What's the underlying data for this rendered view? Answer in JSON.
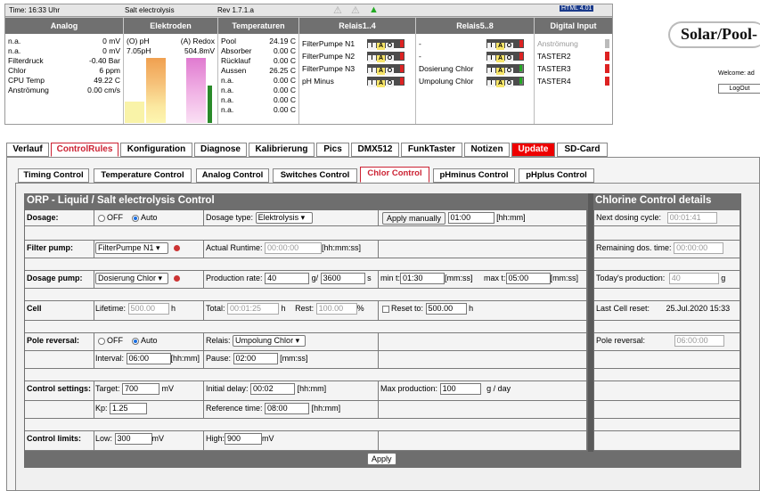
{
  "topbar": {
    "time": "Time: 16:33 Uhr",
    "system": "Salt electrolysis",
    "rev": "Rev 1.7.1.a",
    "html_badge": "HTML 4.01"
  },
  "headers": {
    "analog": "Analog",
    "elektroden": "Elektroden",
    "temps": "Temperaturen",
    "relais14": "Relais1..4",
    "relais58": "Relais5..8",
    "digital": "Digital Input"
  },
  "analog": [
    {
      "name": "n.a.",
      "value": "0 mV"
    },
    {
      "name": "n.a.",
      "value": "0 mV"
    },
    {
      "name": "Filterdruck",
      "value": "-0.40 Bar"
    },
    {
      "name": "Chlor",
      "value": "6 ppm"
    },
    {
      "name": "CPU Temp",
      "value": "49.22 C"
    },
    {
      "name": "Anströmung",
      "value": "0.00 cm/s"
    }
  ],
  "electrodes": {
    "ph_label": "(O) pH",
    "ph_value": "7.05pH",
    "redox_label": "(A) Redox",
    "redox_value": "504.8mV"
  },
  "temps": [
    {
      "name": "Pool",
      "value": "24.19 C"
    },
    {
      "name": "Absorber",
      "value": "0.00 C"
    },
    {
      "name": "Rücklauf",
      "value": "0.00 C"
    },
    {
      "name": "Aussen",
      "value": "26.25 C"
    },
    {
      "name": "n.a.",
      "value": "0.00 C"
    },
    {
      "name": "n.a.",
      "value": "0.00 C"
    },
    {
      "name": "n.a.",
      "value": "0.00 C"
    },
    {
      "name": "n.a.",
      "value": "0.00 C"
    }
  ],
  "relais14": [
    "FilterPumpe N1",
    "FilterPumpe N2",
    "FilterPumpe N3",
    "pH Minus"
  ],
  "relais58": [
    "-",
    "-",
    "Dosierung Chlor",
    "Umpolung Chlor"
  ],
  "iao": {
    "i": "I",
    "a": "A",
    "o": "O"
  },
  "digital": [
    "Anströmung",
    "TASTER2",
    "TASTER3",
    "TASTER4"
  ],
  "brand": {
    "logo": "Solar/Pool-",
    "welcome": "Welcome:  ad",
    "logout": "LogOut"
  },
  "tabs": [
    "Verlauf",
    "ControlRules",
    "Konfiguration",
    "Diagnose",
    "Kalibrierung",
    "Pics",
    "DMX512",
    "FunkTaster",
    "Notizen",
    "Update",
    "SD-Card"
  ],
  "subtabs": [
    "Timing Control",
    "Temperature Control",
    "Analog Control",
    "Switches Control",
    "Chlor Control",
    "pHminus Control",
    "pHplus Control"
  ],
  "orp": {
    "title": "ORP - Liquid / Salt electrolysis Control",
    "dosage_label": "Dosage:",
    "off": "OFF",
    "auto": "Auto",
    "dosage_type_label": "Dosage type:",
    "dosage_type": "Elektrolysis",
    "apply_manually": "Apply manually",
    "manual_time": "01:00",
    "hhmm": "[hh:mm]",
    "filter_label": "Filter pump:",
    "filter_sel": "FilterPumpe N1",
    "runtime_label": "Actual Runtime:",
    "runtime": "00:00:00",
    "hhmmss": "[hh:mm:ss]",
    "pump_label": "Dosage pump:",
    "pump_sel": "Dosierung Chlor",
    "prod_label": "Production rate:",
    "prod_g": "40",
    "g_slash": "g/",
    "prod_s": "3600",
    "s": "s",
    "min_label": "min t:",
    "min_t": "01:30",
    "mmss": "[mm:ss]",
    "max_label": "max t:",
    "max_t": "05:00",
    "cell_label": "Cell",
    "lifetime_label": "Lifetime:",
    "lifetime": "500.00",
    "h": "h",
    "total_label": "Total:",
    "total": "00:01:25",
    "rest_label": "Rest:",
    "rest": "100.00",
    "pct": "%",
    "reset_label": "Reset to:",
    "reset_to": "500.00",
    "pole_label": "Pole reversal:",
    "relais_label": "Relais:",
    "relais_sel": "Umpolung Chlor",
    "interval_label": "Interval:",
    "interval": "06:00",
    "pause_label": "Pause:",
    "pause": "02:00",
    "settings_label": "Control settings:",
    "target_label": "Target:",
    "target": "700",
    "mv": "mV",
    "delay_label": "Initial delay:",
    "delay": "00:02",
    "maxprod_label": "Max production:",
    "maxprod": "100",
    "gday": "g / day",
    "kp_label": "Kp:",
    "kp": "1.25",
    "ref_label": "Reference time:",
    "ref": "08:00",
    "limits_label": "Control limits:",
    "low_label": "Low:",
    "low": "300",
    "high_label": "High:",
    "high": "900",
    "apply": "Apply"
  },
  "details": {
    "title": "Chlorine Control details",
    "next_label": "Next dosing cycle:",
    "next": "00:01:41",
    "remain_label": "Remaining dos. time:",
    "remain": "00:00:00",
    "today_label": "Today's production:",
    "today": "40",
    "g": "g",
    "reset_label": "Last Cell reset:",
    "reset": "25.Jul.2020 15:33",
    "pole_label": "Pole reversal:",
    "pole": "06:00:00"
  }
}
